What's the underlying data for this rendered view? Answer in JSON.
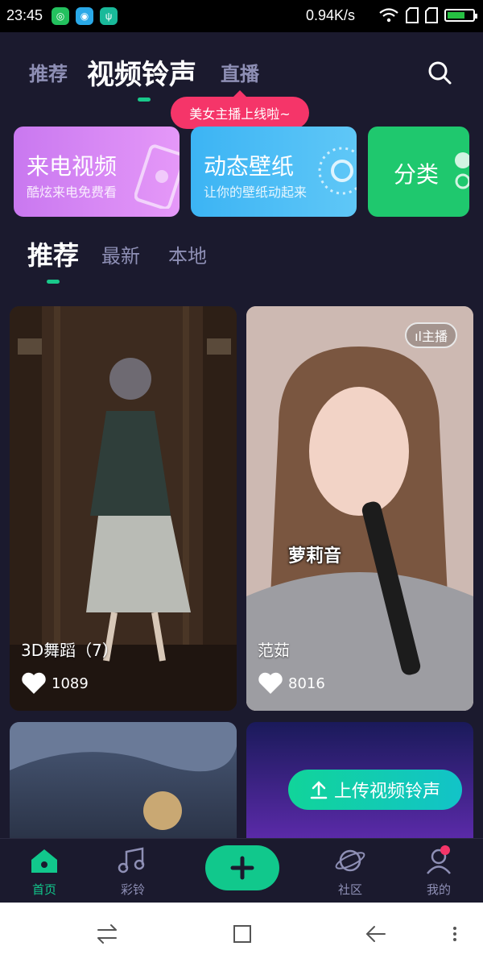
{
  "status": {
    "time": "23:45",
    "speed": "0.94K/s",
    "icons": [
      "app-green-icon",
      "app-blue-icon",
      "usb-icon",
      "wifi-icon",
      "sim-icon",
      "sim-icon",
      "battery-icon"
    ],
    "battery_level": 0.7
  },
  "top_tabs": [
    "推荐",
    "视频铃声",
    "直播"
  ],
  "live_tip": "美女主播上线啦~",
  "feature_cards": [
    {
      "title": "来电视频",
      "subtitle": "酷炫来电免费看",
      "color": "#c978f0"
    },
    {
      "title": "动态壁纸",
      "subtitle": "让你的壁纸动起来",
      "color": "#3cb4f4"
    },
    {
      "title": "分类",
      "subtitle": "",
      "color": "#1fc86e"
    }
  ],
  "sub_tabs": [
    "推荐",
    "最新",
    "本地"
  ],
  "videos": [
    {
      "title": "3D舞蹈（7）",
      "likes": "1089"
    },
    {
      "title": "范茹",
      "likes": "8016",
      "badge": "主播",
      "overlay_text": "萝莉音"
    }
  ],
  "upload_label": "上传视频铃声",
  "bottom_nav": [
    {
      "label": "首页",
      "icon": "home-icon"
    },
    {
      "label": "彩铃",
      "icon": "music-icon"
    },
    {
      "label": "",
      "icon": "plus-icon"
    },
    {
      "label": "社区",
      "icon": "planet-icon"
    },
    {
      "label": "我的",
      "icon": "profile-icon"
    }
  ],
  "colors": {
    "accent": "#11c88c",
    "live": "#f53569",
    "background": "#1b1a2e"
  }
}
